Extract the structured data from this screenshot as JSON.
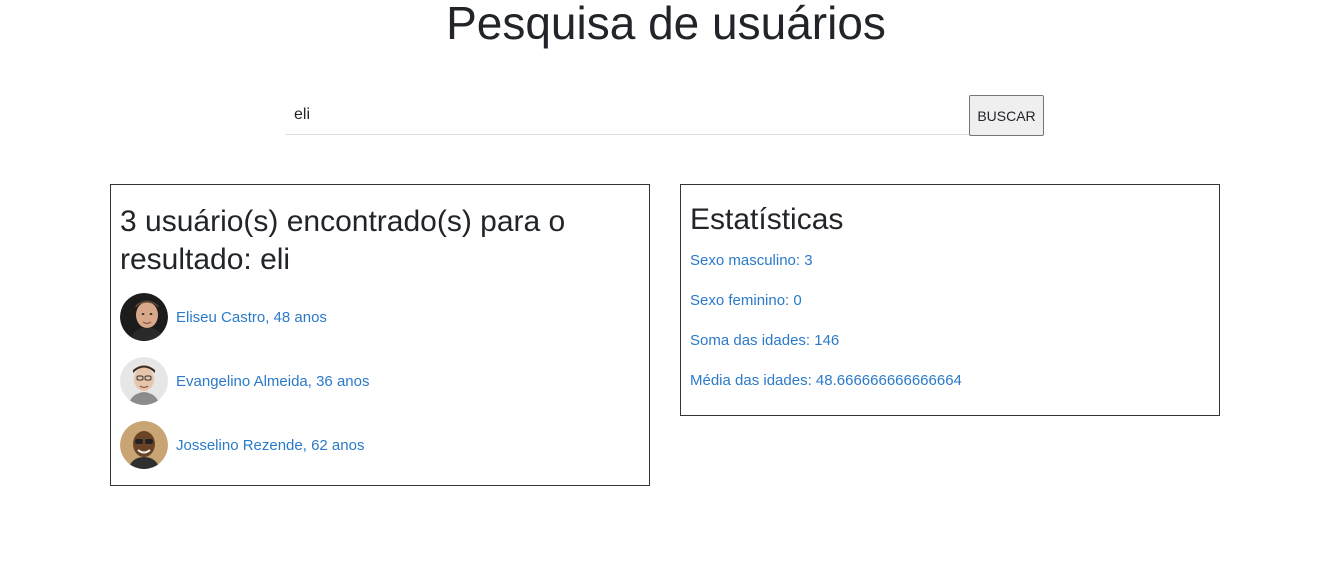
{
  "header": {
    "title": "Pesquisa de usuários"
  },
  "search": {
    "value": "eli",
    "placeholder": "",
    "button_label": "BUSCAR"
  },
  "results": {
    "heading": "3 usuário(s) encontrado(s) para o resultado: eli",
    "users": [
      {
        "label": "Eliseu Castro, 48 anos",
        "avatar": "avatar-photo"
      },
      {
        "label": "Evangelino Almeida, 36 anos",
        "avatar": "avatar-photo"
      },
      {
        "label": "Josselino Rezende, 62 anos",
        "avatar": "avatar-photo"
      }
    ]
  },
  "stats": {
    "heading": "Estatísticas",
    "items": [
      "Sexo masculino: 3",
      "Sexo feminino: 0",
      "Soma das idades: 146",
      "Média das idades: 48.666666666666664"
    ]
  },
  "colors": {
    "link": "#2a7ac9",
    "text": "#212529",
    "border": "#333333"
  }
}
